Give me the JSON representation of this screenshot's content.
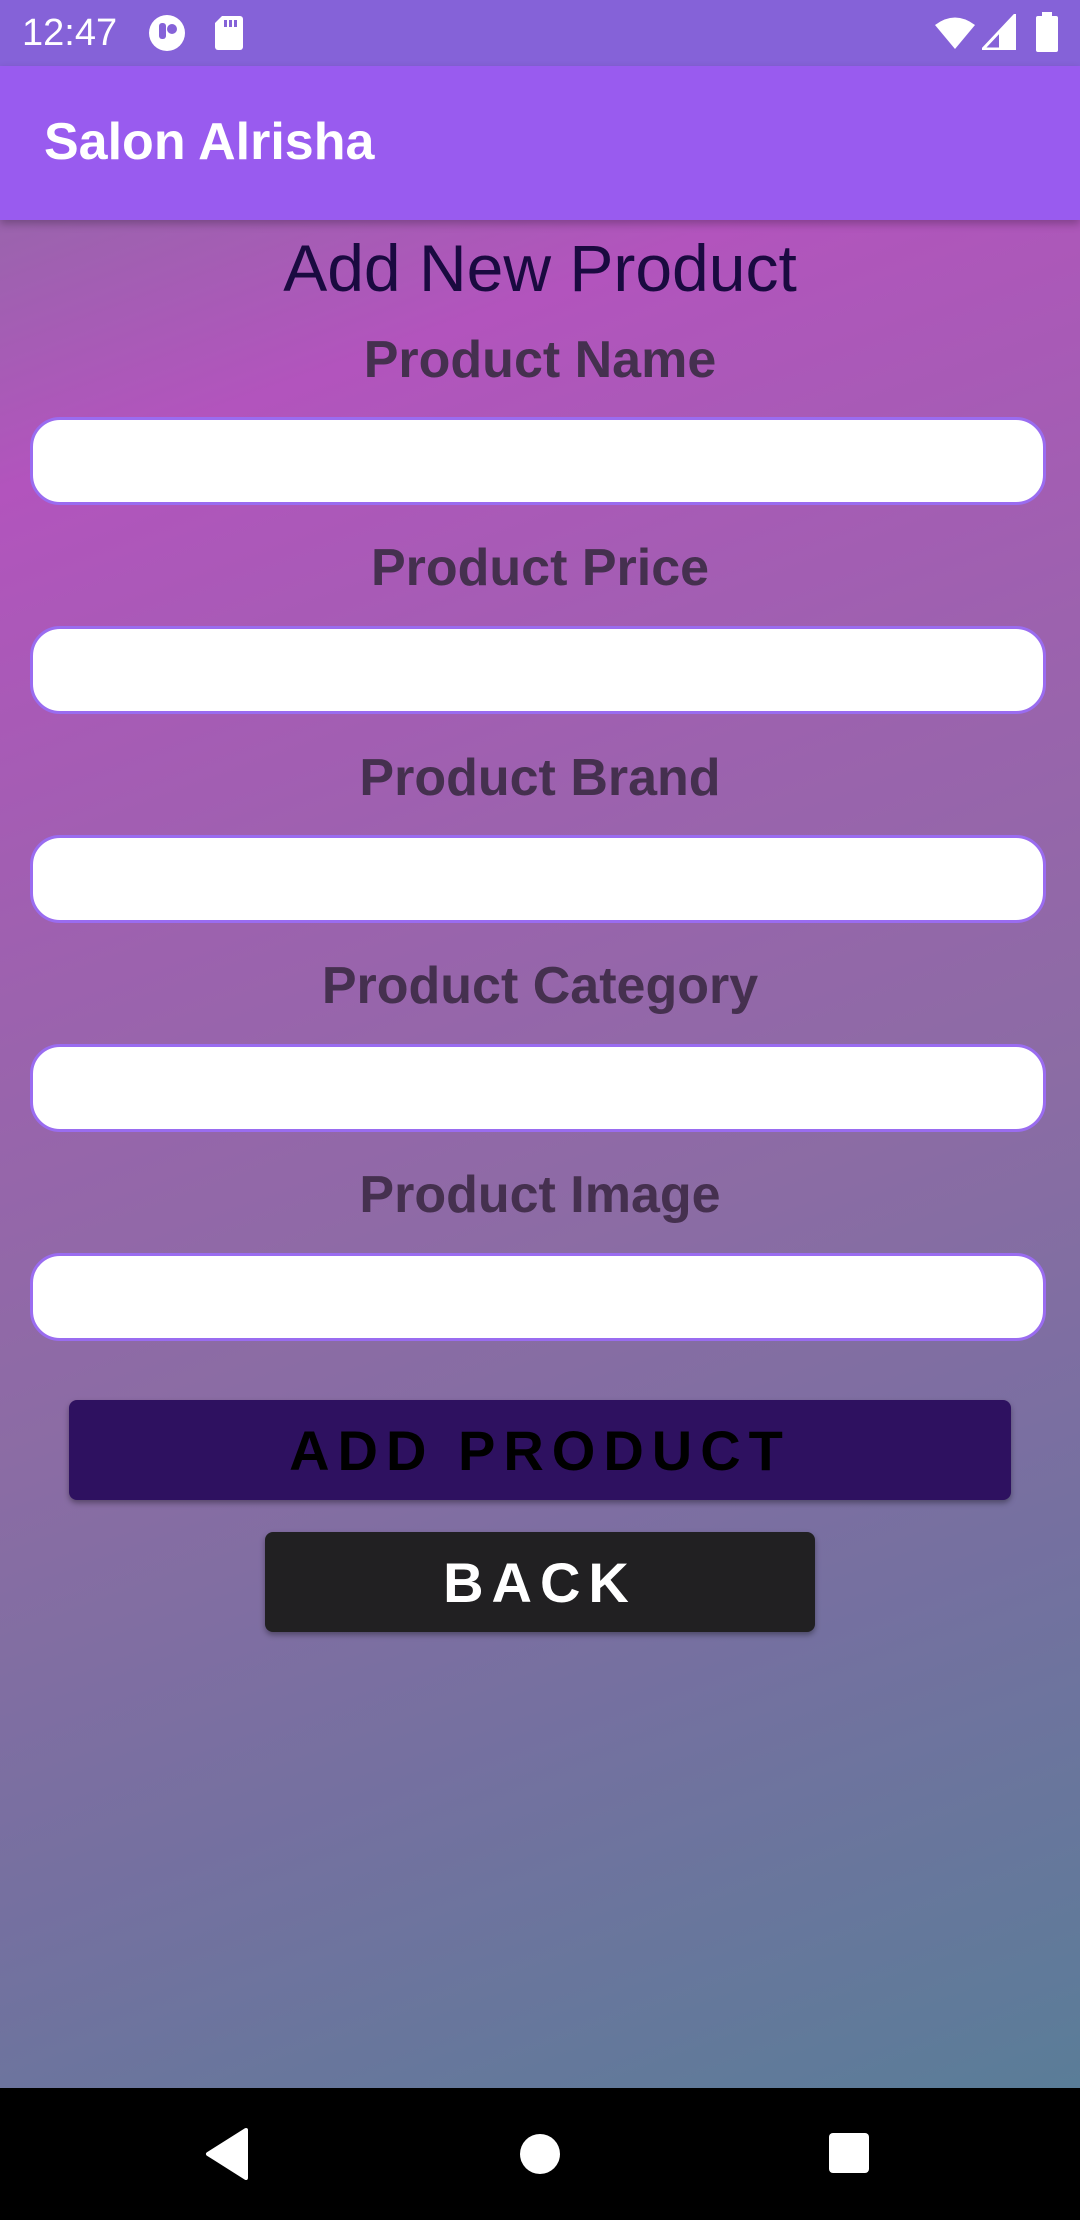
{
  "status_bar": {
    "time": "12:47",
    "icons": [
      "app-notification-icon",
      "sd-card-icon",
      "wifi-icon",
      "cell-signal-icon",
      "battery-icon"
    ]
  },
  "app_bar": {
    "title": "Salon Alrisha",
    "color": "#995bef"
  },
  "form": {
    "title": "Add New Product",
    "fields": [
      {
        "label": "Product Name",
        "value": ""
      },
      {
        "label": "Product Price",
        "value": ""
      },
      {
        "label": "Product Brand",
        "value": ""
      },
      {
        "label": "Product Category",
        "value": ""
      },
      {
        "label": "Product Image",
        "value": ""
      }
    ],
    "add_button": "ADD PRODUCT",
    "back_button": "BACK"
  },
  "colors": {
    "accent": "#995bef",
    "add_button_bg": "#2e1160",
    "back_button_bg": "#212022",
    "input_border": "#9a6cf0"
  },
  "nav_bar": {
    "icons": [
      "back-triangle-icon",
      "home-circle-icon",
      "recents-square-icon"
    ]
  }
}
